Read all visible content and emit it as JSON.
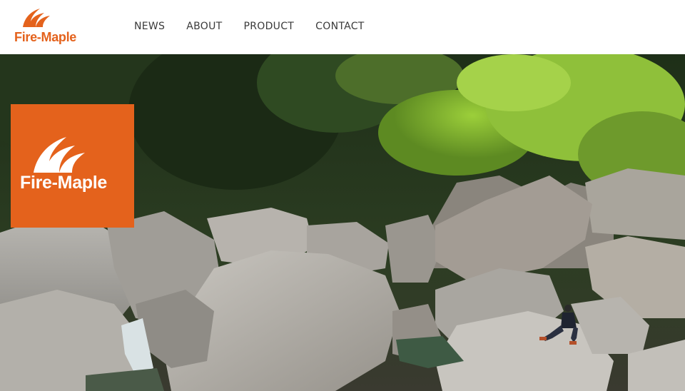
{
  "brand": {
    "name": "Fire-Maple",
    "color": "#e4621c"
  },
  "nav": {
    "items": [
      {
        "label": "NEWS"
      },
      {
        "label": "ABOUT"
      },
      {
        "label": "PRODUCT"
      },
      {
        "label": "CONTACT"
      }
    ]
  },
  "hero": {
    "badge_text": "Fire-Maple",
    "badge_color": "#e4621c"
  }
}
